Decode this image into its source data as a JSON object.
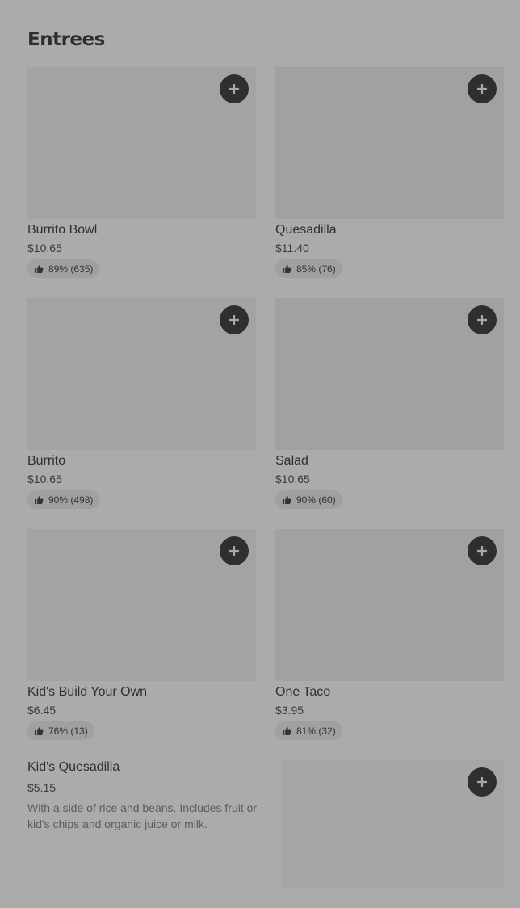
{
  "section": {
    "title": "Entrees"
  },
  "items": [
    {
      "name": "Burrito Bowl",
      "price": "$10.65",
      "rating": "89% (635)"
    },
    {
      "name": "Quesadilla",
      "price": "$11.40",
      "rating": "85% (76)"
    },
    {
      "name": "Burrito",
      "price": "$10.65",
      "rating": "90% (498)"
    },
    {
      "name": "Salad",
      "price": "$10.65",
      "rating": "90% (60)"
    },
    {
      "name": "Kid's Build Your Own",
      "price": "$6.45",
      "rating": "76% (13)"
    },
    {
      "name": "One Taco",
      "price": "$3.95",
      "rating": "81% (32)"
    }
  ],
  "featured": {
    "name": "Kid's Quesadilla",
    "price": "$5.15",
    "description": "With a side of rice and beans. Includes fruit or kid's chips and organic juice or milk."
  },
  "icons": {
    "add": "plus-icon",
    "rating": "thumbs-up-icon"
  }
}
